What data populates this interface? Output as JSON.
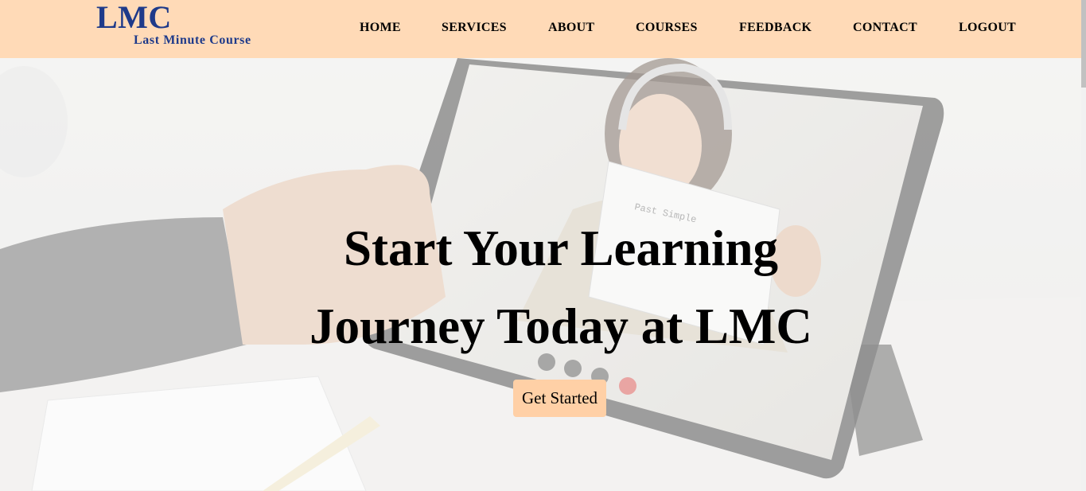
{
  "brand": {
    "title": "LMC",
    "subtitle": "Last Minute Course"
  },
  "nav": {
    "items": [
      {
        "label": "HOME"
      },
      {
        "label": "SERVICES"
      },
      {
        "label": "ABOUT"
      },
      {
        "label": "COURSES"
      },
      {
        "label": "FEEDBACK"
      },
      {
        "label": "CONTACT"
      },
      {
        "label": "LOGOUT"
      }
    ]
  },
  "hero": {
    "heading_line1": "Start Your Learning",
    "heading_line2": "Journey Today at LMC",
    "cta_label": "Get Started",
    "image_text": {
      "sheet_title": "Past Simple"
    }
  },
  "colors": {
    "header_bg": "#ffdab7",
    "brand": "#1e3a8a",
    "cta_bg": "#ffd0a6",
    "heading": "#000000"
  }
}
